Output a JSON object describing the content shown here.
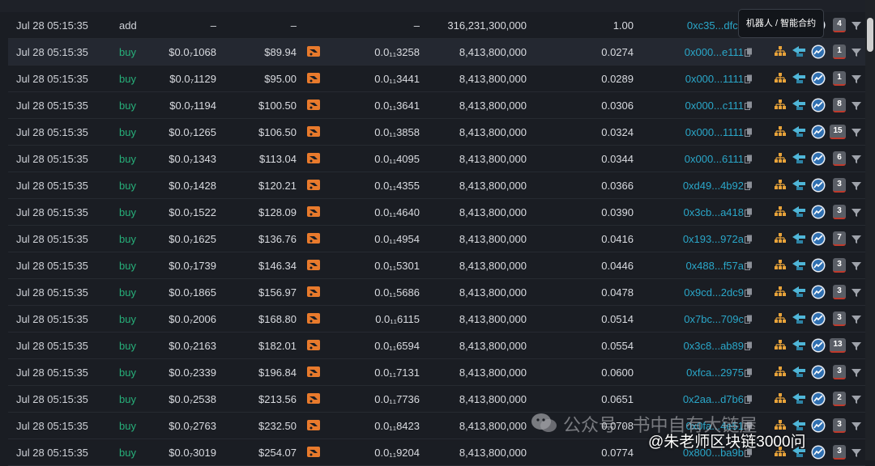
{
  "colors": {
    "buy": "#27b07a",
    "maker": "#2aa7c9",
    "badge_bg": "#5a5e66",
    "tree_icon": "#e8a33a",
    "swap_icon": "#4fb6d8",
    "exchange_icon": "#e87a2c"
  },
  "tooltip": "机器人 / 智能合约",
  "rows": [
    {
      "time": "Jul 28 05:15:35",
      "type": "add",
      "price": "–",
      "usd": "–",
      "token_price": "–",
      "amount": "316,231,300,000",
      "ratio": "1.00",
      "maker": "0xc35...dfcb",
      "badge": "4"
    },
    {
      "time": "Jul 28 05:15:35",
      "type": "buy",
      "price": "$0.0₇1068",
      "usd": "$89.94",
      "token_price": "0.0₁₁3258",
      "amount": "8,413,800,000",
      "ratio": "0.0274",
      "maker": "0x000...e111",
      "badge": "1"
    },
    {
      "time": "Jul 28 05:15:35",
      "type": "buy",
      "price": "$0.0₇1129",
      "usd": "$95.00",
      "token_price": "0.0₁₁3441",
      "amount": "8,413,800,000",
      "ratio": "0.0289",
      "maker": "0x000...1111",
      "badge": "1"
    },
    {
      "time": "Jul 28 05:15:35",
      "type": "buy",
      "price": "$0.0₇1194",
      "usd": "$100.50",
      "token_price": "0.0₁₁3641",
      "amount": "8,413,800,000",
      "ratio": "0.0306",
      "maker": "0x000...c111",
      "badge": "8"
    },
    {
      "time": "Jul 28 05:15:35",
      "type": "buy",
      "price": "$0.0₇1265",
      "usd": "$106.50",
      "token_price": "0.0₁₁3858",
      "amount": "8,413,800,000",
      "ratio": "0.0324",
      "maker": "0x000...1111",
      "badge": "15"
    },
    {
      "time": "Jul 28 05:15:35",
      "type": "buy",
      "price": "$0.0₇1343",
      "usd": "$113.04",
      "token_price": "0.0₁₁4095",
      "amount": "8,413,800,000",
      "ratio": "0.0344",
      "maker": "0x000...6111",
      "badge": "6"
    },
    {
      "time": "Jul 28 05:15:35",
      "type": "buy",
      "price": "$0.0₇1428",
      "usd": "$120.21",
      "token_price": "0.0₁₁4355",
      "amount": "8,413,800,000",
      "ratio": "0.0366",
      "maker": "0xd49...4b92",
      "badge": "3"
    },
    {
      "time": "Jul 28 05:15:35",
      "type": "buy",
      "price": "$0.0₇1522",
      "usd": "$128.09",
      "token_price": "0.0₁₁4640",
      "amount": "8,413,800,000",
      "ratio": "0.0390",
      "maker": "0x3cb...a418",
      "badge": "3"
    },
    {
      "time": "Jul 28 05:15:35",
      "type": "buy",
      "price": "$0.0₇1625",
      "usd": "$136.76",
      "token_price": "0.0₁₁4954",
      "amount": "8,413,800,000",
      "ratio": "0.0416",
      "maker": "0x193...972a",
      "badge": "7"
    },
    {
      "time": "Jul 28 05:15:35",
      "type": "buy",
      "price": "$0.0₇1739",
      "usd": "$146.34",
      "token_price": "0.0₁₁5301",
      "amount": "8,413,800,000",
      "ratio": "0.0446",
      "maker": "0x488...f57a",
      "badge": "3"
    },
    {
      "time": "Jul 28 05:15:35",
      "type": "buy",
      "price": "$0.0₇1865",
      "usd": "$156.97",
      "token_price": "0.0₁₁5686",
      "amount": "8,413,800,000",
      "ratio": "0.0478",
      "maker": "0x9cd...2dc9",
      "badge": "3"
    },
    {
      "time": "Jul 28 05:15:35",
      "type": "buy",
      "price": "$0.0₇2006",
      "usd": "$168.80",
      "token_price": "0.0₁₁6115",
      "amount": "8,413,800,000",
      "ratio": "0.0514",
      "maker": "0x7bc...709c",
      "badge": "3"
    },
    {
      "time": "Jul 28 05:15:35",
      "type": "buy",
      "price": "$0.0₇2163",
      "usd": "$182.01",
      "token_price": "0.0₁₁6594",
      "amount": "8,413,800,000",
      "ratio": "0.0554",
      "maker": "0x3c8...ab89",
      "badge": "13"
    },
    {
      "time": "Jul 28 05:15:35",
      "type": "buy",
      "price": "$0.0₇2339",
      "usd": "$196.84",
      "token_price": "0.0₁₁7131",
      "amount": "8,413,800,000",
      "ratio": "0.0600",
      "maker": "0xfca...2975",
      "badge": "3"
    },
    {
      "time": "Jul 28 05:15:35",
      "type": "buy",
      "price": "$0.0₇2538",
      "usd": "$213.56",
      "token_price": "0.0₁₁7736",
      "amount": "8,413,800,000",
      "ratio": "0.0651",
      "maker": "0x2aa...d7b6",
      "badge": "2"
    },
    {
      "time": "Jul 28 05:15:35",
      "type": "buy",
      "price": "$0.0₇2763",
      "usd": "$232.50",
      "token_price": "0.0₁₁8423",
      "amount": "8,413,800,000",
      "ratio": "0.0708",
      "maker": "0x0fa...4e51",
      "badge": "3"
    },
    {
      "time": "Jul 28 05:15:35",
      "type": "buy",
      "price": "$0.0₇3019",
      "usd": "$254.07",
      "token_price": "0.0₁₁9204",
      "amount": "8,413,800,000",
      "ratio": "0.0774",
      "maker": "0x800...ba9b",
      "badge": "3"
    }
  ],
  "watermark": {
    "text1": "公众号 · 书中自有大链屋",
    "text2": "@朱老师区块链3000问"
  }
}
